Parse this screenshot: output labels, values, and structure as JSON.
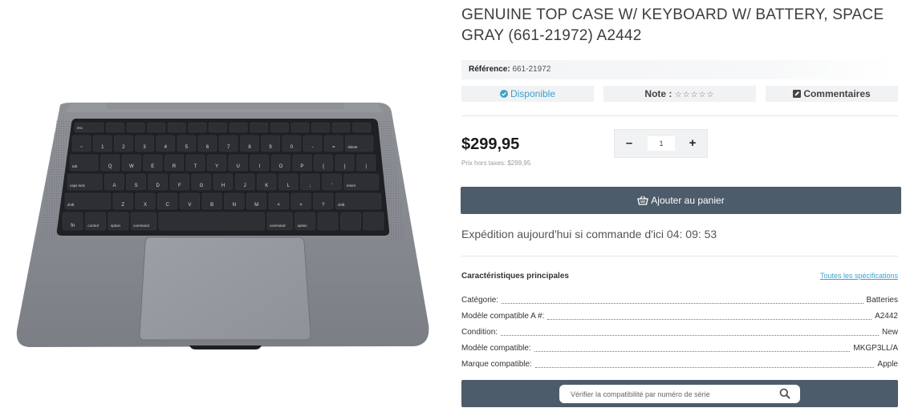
{
  "product": {
    "title": "GENUINE TOP CASE W/ KEYBOARD W/ BATTERY, SPACE GRAY (661-21972) A2442",
    "reference_label": "Référence:",
    "reference_value": "661-21972",
    "availability": "Disponible",
    "rating_label": "Note :",
    "rating_stars": "☆☆☆☆☆",
    "rating_value": 0,
    "comments_label": "Commentaires",
    "price": "$299,95",
    "price_ht": "Prix hors taxes: $299,95",
    "quantity": "1",
    "add_to_cart": "Ajouter au panier",
    "shipping_text": "Expédition aujourd'hui si commande d'ici 04: 09: 53"
  },
  "specs": {
    "title": "Caractéristiques principales",
    "all_link": "Toutes les spécifications",
    "rows": [
      {
        "key": "Catégorie:",
        "value": "Batteries"
      },
      {
        "key": "Modèle compatible A #:",
        "value": "A2442"
      },
      {
        "key": "Condition:",
        "value": "New"
      },
      {
        "key": "Modèle compatible:",
        "value": "MKGP3LL/A"
      },
      {
        "key": "Marque compatible:",
        "value": "Apple"
      }
    ]
  },
  "verify": {
    "placeholder": "Vérifier la compatibilité par numéro de série"
  },
  "keyboard": {
    "row0": [
      "esc",
      "",
      "",
      "",
      "",
      "",
      "",
      "",
      "",
      "",
      "",
      "",
      "",
      ""
    ],
    "row1": [
      "~",
      "1",
      "2",
      "3",
      "4",
      "5",
      "6",
      "7",
      "8",
      "9",
      "0",
      "-",
      "=",
      "delete"
    ],
    "row2": [
      "tab",
      "Q",
      "W",
      "E",
      "R",
      "T",
      "Y",
      "U",
      "I",
      "O",
      "P",
      "{",
      "}",
      "|"
    ],
    "row3": [
      "caps lock",
      "A",
      "S",
      "D",
      "F",
      "G",
      "H",
      "J",
      "K",
      "L",
      ";",
      "'",
      "return"
    ],
    "row4": [
      "shift",
      "Z",
      "X",
      "C",
      "V",
      "B",
      "N",
      "M",
      "<",
      ">",
      "?",
      "shift"
    ],
    "row5": [
      "fn",
      "control",
      "option",
      "command",
      "",
      "command",
      "option",
      "",
      "",
      ""
    ]
  },
  "colors": {
    "accent": "#3ea1cb",
    "button_dark": "#4d5c6a",
    "chassis": "#7a7d83",
    "keys": "#2e2f33"
  }
}
